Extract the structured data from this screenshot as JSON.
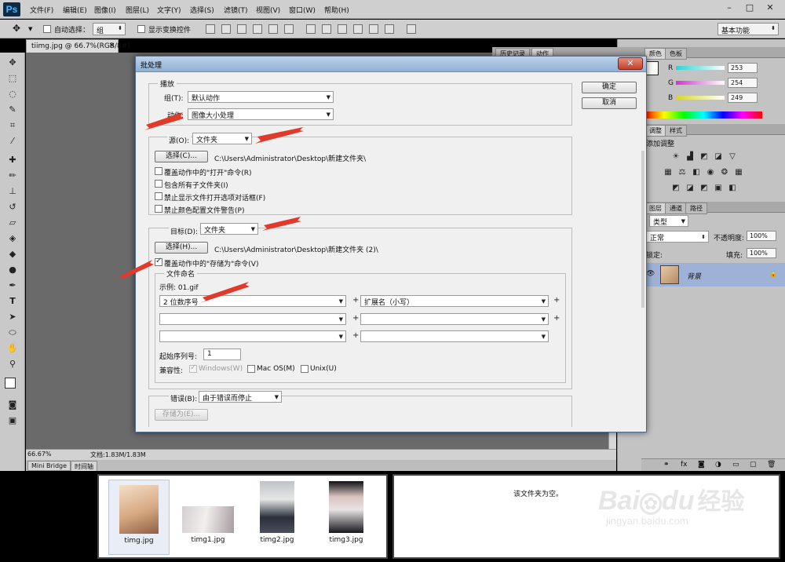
{
  "app": {
    "logo": "Ps",
    "menu": [
      "文件(F)",
      "编辑(E)",
      "图像(I)",
      "图层(L)",
      "文字(Y)",
      "选择(S)",
      "滤镜(T)",
      "视图(V)",
      "窗口(W)",
      "帮助(H)"
    ],
    "window_buttons": [
      "–",
      "□",
      "✕"
    ]
  },
  "options_bar": {
    "auto_select_label": "自动选择：",
    "auto_select_value": "组",
    "show_transform_label": "显示变换控件",
    "workspace": "基本功能"
  },
  "document": {
    "tab_title": "tiimg.jpg @ 66.7%(RGB/8#)",
    "zoom": "66.67%",
    "doc_info": "文档:1.83M/1.83M",
    "bottom_tabs": [
      "Mini Bridge",
      "时间轴"
    ]
  },
  "panels": {
    "history_tabs": [
      "历史记录",
      "动作"
    ],
    "color_tabs": [
      "颜色",
      "色板"
    ],
    "channels": [
      {
        "label": "R",
        "value": "253",
        "color": "#31d6d6"
      },
      {
        "label": "G",
        "value": "254",
        "color": "#d63bd6"
      },
      {
        "label": "B",
        "value": "249",
        "color": "#d6d630"
      }
    ],
    "adjust_tabs": [
      "调整",
      "样式"
    ],
    "adjust_title": "添加调整",
    "layers_tabs": [
      "图层",
      "通道",
      "路径"
    ],
    "kind_label": "类型",
    "blend_mode": "正常",
    "opacity_label": "不透明度:",
    "opacity_value": "100%",
    "lock_label": "锁定:",
    "fill_label": "填充:",
    "fill_value": "100%",
    "layer_name": "背景"
  },
  "dialog": {
    "title": "批处理",
    "ok": "确定",
    "cancel": "取消",
    "play": {
      "legend": "播放",
      "set_label": "组(T):",
      "set_value": "默认动作",
      "action_label": "动作:",
      "action_value": "图像大小处理"
    },
    "source": {
      "label": "源(O):",
      "value": "文件夹",
      "choose_button": "选择(C)...",
      "path": "C:\\Users\\Administrator\\Desktop\\新建文件夹\\",
      "options": [
        {
          "label": "覆盖动作中的\"打开\"命令(R)",
          "checked": false
        },
        {
          "label": "包含所有子文件夹(I)",
          "checked": false
        },
        {
          "label": "禁止显示文件打开选项对话框(F)",
          "checked": false
        },
        {
          "label": "禁止颜色配置文件警告(P)",
          "checked": false
        }
      ]
    },
    "destination": {
      "label": "目标(D):",
      "value": "文件夹",
      "choose_button": "选择(H)...",
      "path": "C:\\Users\\Administrator\\Desktop\\新建文件夹 (2)\\",
      "override_label": "覆盖动作中的\"存储为\"命令(V)",
      "override_checked": true
    },
    "naming": {
      "legend": "文件命名",
      "example": "示例: 01.gif",
      "rows": [
        [
          "2 位数序号",
          "扩展名（小写）"
        ],
        [
          "",
          ""
        ],
        [
          "",
          ""
        ]
      ],
      "start_serial_label": "起始序列号:",
      "start_serial_value": "1",
      "compat_label": "兼容性:",
      "compat": [
        {
          "label": "Windows(W)",
          "checked": true,
          "disabled": true
        },
        {
          "label": "Mac OS(M)",
          "checked": false,
          "disabled": false
        },
        {
          "label": "Unix(U)",
          "checked": false,
          "disabled": false
        }
      ]
    },
    "errors": {
      "label": "错误(B):",
      "value": "由于错误而停止",
      "save_as_button": "存储为(E)..."
    }
  },
  "browser": {
    "thumbnails": [
      {
        "name": "timg.jpg",
        "selected": true
      },
      {
        "name": "timg1.jpg",
        "selected": false
      },
      {
        "name": "timg2.jpg",
        "selected": false
      },
      {
        "name": "timg3.jpg",
        "selected": false
      }
    ],
    "empty_message": "该文件夹为空。"
  },
  "watermark": {
    "brand": "Bai",
    "brand2": "du",
    "suffix": "经验",
    "url": "jingyan.baidu.com"
  },
  "colors": {
    "arrow": "#e23a2a",
    "selected_layer": "#9db2d6",
    "dialog_title": "#9fbde0"
  }
}
